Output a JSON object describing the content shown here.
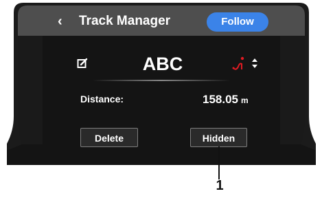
{
  "header": {
    "title": "Track Manager",
    "follow_label": "Follow"
  },
  "track": {
    "name": "ABC",
    "distance_label": "Distance:",
    "distance_value": "158.05",
    "distance_unit": "m"
  },
  "actions": {
    "delete_label": "Delete",
    "hidden_label": "Hidden"
  },
  "callout": {
    "number": "1"
  },
  "icons": {
    "back": "chevron-left-icon",
    "edit": "edit-icon",
    "track": "track-icon",
    "sort": "sort-arrows-icon"
  },
  "colors": {
    "header_bg": "#4e4e4e",
    "screen_bg": "#141414",
    "accent_blue": "#3b83e8",
    "track_icon_red": "#e31b23"
  }
}
